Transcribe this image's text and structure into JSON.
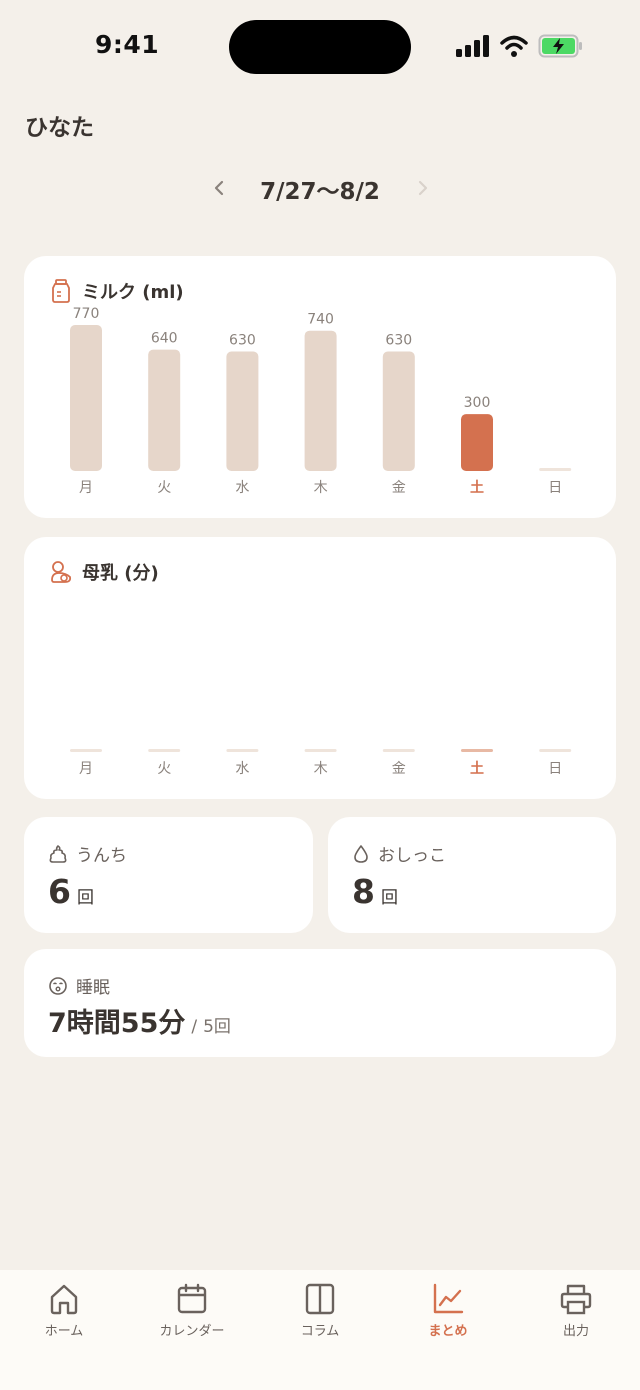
{
  "status_bar": {
    "time": "9:41"
  },
  "header": {
    "child_name": "ひなた"
  },
  "week_nav": {
    "label": "7/27〜8/2",
    "prev_icon": "chevron-left-icon",
    "next_icon": "chevron-right-icon"
  },
  "colors": {
    "accent": "#d4714f",
    "bar": "#e6d6ca",
    "background": "#f4f0ea"
  },
  "milk": {
    "title": "ミルク (ml)",
    "icon": "bottle-icon",
    "chart_data": {
      "type": "bar",
      "categories": [
        "月",
        "火",
        "水",
        "木",
        "金",
        "土",
        "日"
      ],
      "values": [
        770,
        640,
        630,
        740,
        630,
        300,
        0
      ],
      "highlight_index": 5,
      "data_labels": [
        "770",
        "640",
        "630",
        "740",
        "630",
        "300",
        ""
      ],
      "ylim": [
        0,
        800
      ]
    }
  },
  "breast": {
    "title": "母乳 (分)",
    "icon": "breastfeeding-icon",
    "chart_data": {
      "type": "bar",
      "categories": [
        "月",
        "火",
        "水",
        "木",
        "金",
        "土",
        "日"
      ],
      "values": [
        0,
        0,
        0,
        0,
        0,
        0,
        0
      ],
      "highlight_index": 5
    }
  },
  "poop": {
    "label": "うんち",
    "icon": "poop-icon",
    "value": "6",
    "unit": "回"
  },
  "pee": {
    "label": "おしっこ",
    "icon": "droplet-icon",
    "value": "8",
    "unit": "回"
  },
  "sleep": {
    "label": "睡眠",
    "icon": "sleep-face-icon",
    "duration": "7時間55分",
    "separator": "/",
    "count": "5回"
  },
  "tabs": [
    {
      "label": "ホーム",
      "icon": "home-icon",
      "active": false
    },
    {
      "label": "カレンダー",
      "icon": "calendar-icon",
      "active": false
    },
    {
      "label": "コラム",
      "icon": "book-icon",
      "active": false
    },
    {
      "label": "まとめ",
      "icon": "chart-icon",
      "active": true
    },
    {
      "label": "出力",
      "icon": "printer-icon",
      "active": false
    }
  ]
}
